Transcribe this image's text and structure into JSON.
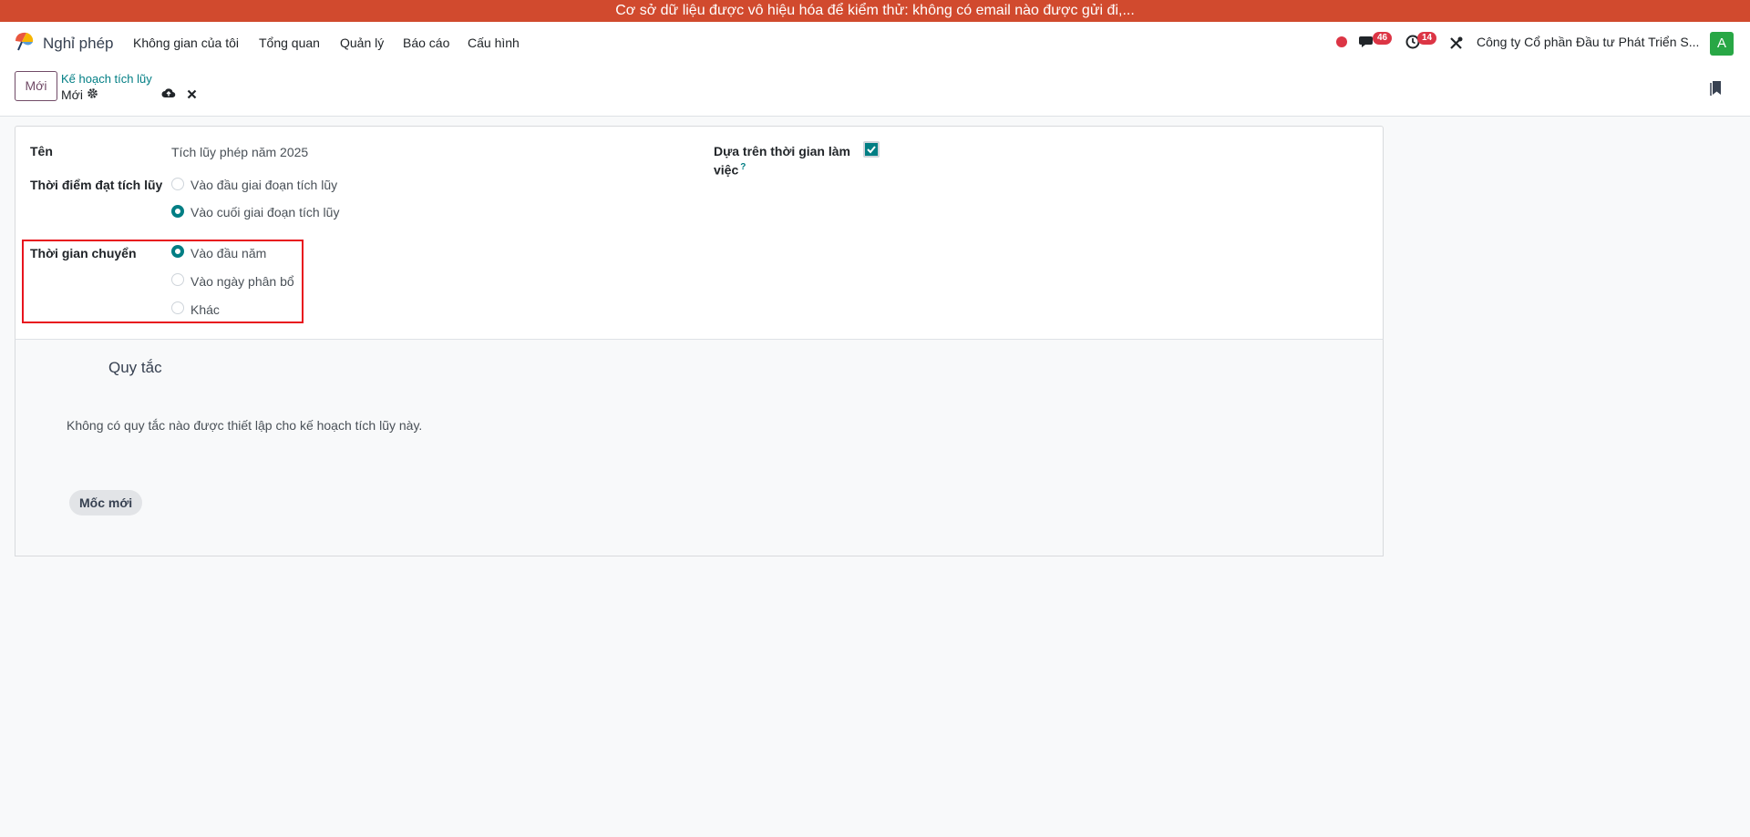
{
  "banner": {
    "text": "Cơ sở dữ liệu được vô hiệu hóa để kiểm thử: không có email nào được gửi đi,..."
  },
  "navbar": {
    "app_name": "Nghỉ phép",
    "menu": [
      "Không gian của tôi",
      "Tổng quan",
      "Quản lý",
      "Báo cáo",
      "Cấu hình"
    ],
    "messages_count": "46",
    "activities_count": "14",
    "company": "Công ty Cổ phần Đầu tư Phát Triển S...",
    "avatar_letter": "A"
  },
  "controlbar": {
    "new_label": "Mới",
    "breadcrumb": "Kế hoạch tích lũy",
    "record_name": "Mới"
  },
  "form": {
    "name_label": "Tên",
    "name_value": "Tích lũy phép năm 2025",
    "gain_time_label": "Thời điểm đạt tích lũy",
    "gain_time_options": [
      "Vào đầu giai đoạn tích lũy",
      "Vào cuối giai đoạn tích lũy"
    ],
    "gain_time_selected": 1,
    "carryover_label": "Thời gian chuyển",
    "carryover_options": [
      "Vào đầu năm",
      "Vào ngày phân bổ",
      "Khác"
    ],
    "carryover_selected": 0,
    "worked_time_label_1": "Dựa trên thời gian làm",
    "worked_time_label_2": "việc",
    "worked_time_help": "?",
    "worked_time_checked": true
  },
  "rules": {
    "title": "Quy tắc",
    "empty_message": "Không có quy tắc nào được thiết lập cho kế hoạch tích lũy này.",
    "new_milestone_label": "Mốc mới"
  },
  "colors": {
    "banner": "#d14a2e",
    "accent": "#017e84",
    "primary": "#714b67",
    "badge": "#dc3545",
    "highlight": "#e8141e"
  }
}
